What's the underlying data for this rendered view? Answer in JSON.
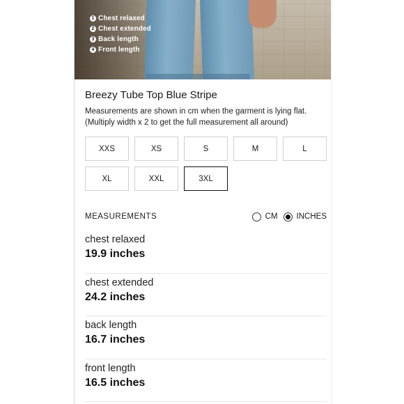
{
  "photo_legend": [
    {
      "num": "1",
      "label": "Chest relaxed"
    },
    {
      "num": "2",
      "label": "Chest extended"
    },
    {
      "num": "3",
      "label": "Back length"
    },
    {
      "num": "4",
      "label": "Front length"
    }
  ],
  "product": {
    "title": "Breezy Tube Top Blue Stripe",
    "description": "Measurements are shown in cm when the garment is lying flat. (Multiply width x 2 to get the full measurement all around)"
  },
  "sizes": [
    "XXS",
    "XS",
    "S",
    "M",
    "L",
    "XL",
    "XXL",
    "3XL"
  ],
  "selected_size": "3XL",
  "measurements": {
    "header": "MEASUREMENTS",
    "units": [
      {
        "label": "CM",
        "selected": false
      },
      {
        "label": "INCHES",
        "selected": true
      }
    ],
    "rows": [
      {
        "name": "chest relaxed",
        "value": "19.9 inches"
      },
      {
        "name": "chest extended",
        "value": "24.2 inches"
      },
      {
        "name": "back length",
        "value": "16.7 inches"
      },
      {
        "name": "front length",
        "value": "16.5 inches"
      }
    ]
  }
}
